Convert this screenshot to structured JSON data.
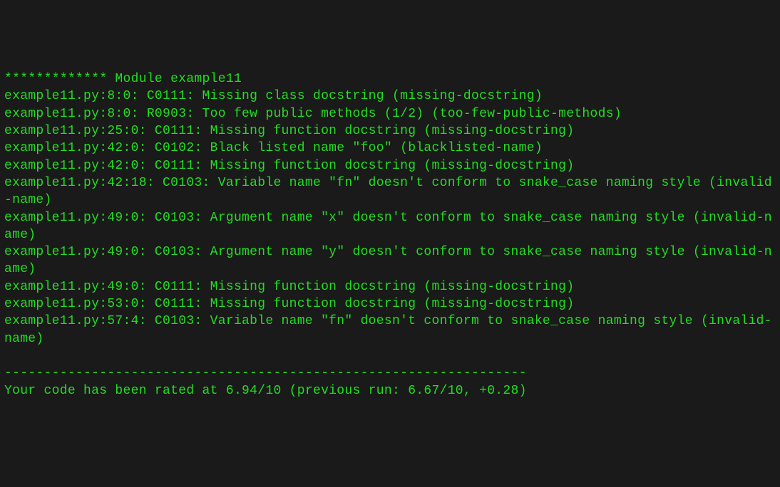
{
  "module_header": "************* Module example11",
  "messages": [
    "example11.py:8:0: C0111: Missing class docstring (missing-docstring)",
    "example11.py:8:0: R0903: Too few public methods (1/2) (too-few-public-methods)",
    "example11.py:25:0: C0111: Missing function docstring (missing-docstring)",
    "example11.py:42:0: C0102: Black listed name \"foo\" (blacklisted-name)",
    "example11.py:42:0: C0111: Missing function docstring (missing-docstring)",
    "example11.py:42:18: C0103: Variable name \"fn\" doesn't conform to snake_case naming style (invalid-name)",
    "example11.py:49:0: C0103: Argument name \"x\" doesn't conform to snake_case naming style (invalid-name)",
    "example11.py:49:0: C0103: Argument name \"y\" doesn't conform to snake_case naming style (invalid-name)",
    "example11.py:49:0: C0111: Missing function docstring (missing-docstring)",
    "example11.py:53:0: C0111: Missing function docstring (missing-docstring)",
    "example11.py:57:4: C0103: Variable name \"fn\" doesn't conform to snake_case naming style (invalid-name)"
  ],
  "separator": "------------------------------------------------------------------",
  "rating": "Your code has been rated at 6.94/10 (previous run: 6.67/10, +0.28)"
}
